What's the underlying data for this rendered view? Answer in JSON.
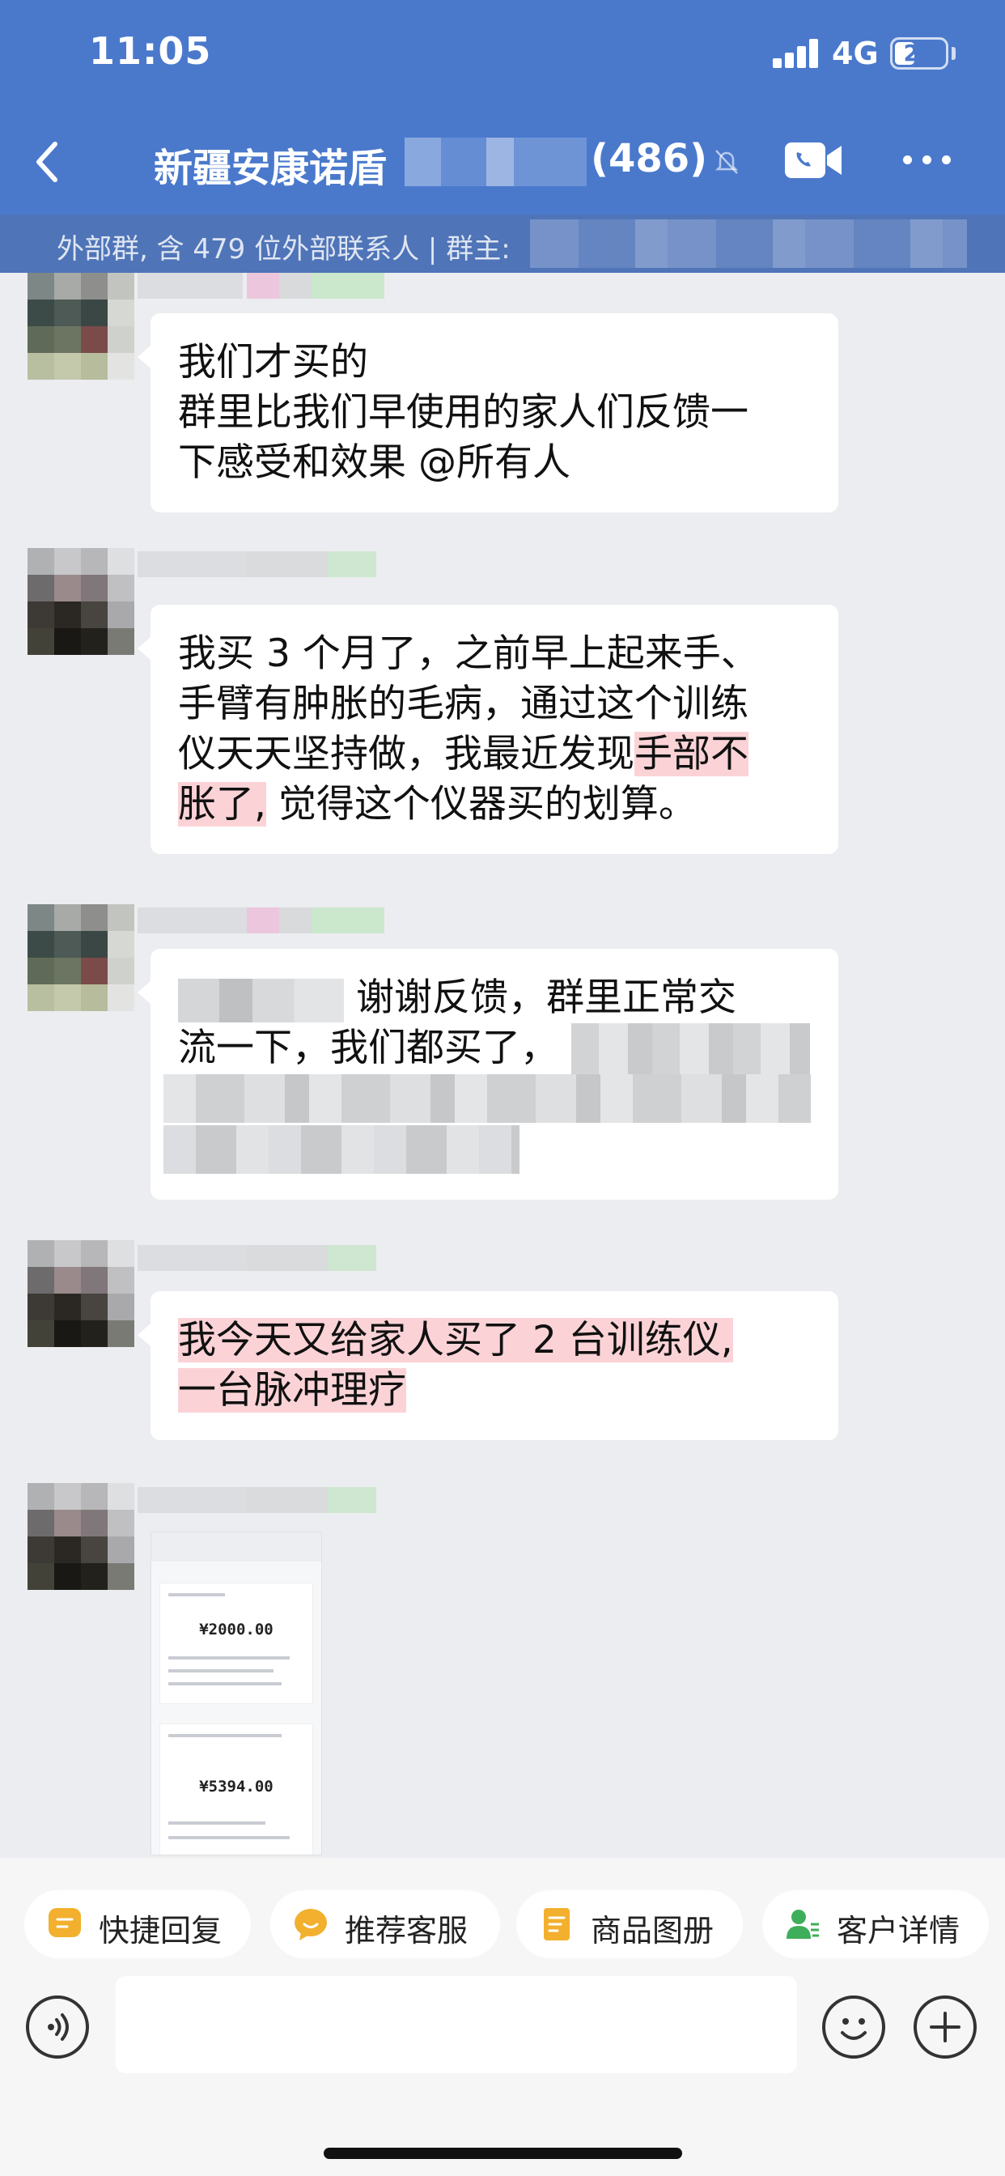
{
  "status_bar": {
    "time": "11:05",
    "network": "4G",
    "battery": "21"
  },
  "nav": {
    "title": "新疆安康诺盾",
    "member_count": "(486)"
  },
  "subheader": {
    "text": "外部群, 含 479 位外部联系人 | 群主:"
  },
  "messages": [
    {
      "lines": [
        "我们才买的",
        "群里比我们早使用的家人们反馈一",
        "下感受和效果 @所有人"
      ]
    },
    {
      "part1": "我买 3 个月了，之前早上起来手、",
      "part2": "手臂有肿胀的毛病，通过这个训练",
      "part3": "仪天天坚持做，我最近发现",
      "highlight1": "手部不",
      "highlight2": "胀了,",
      "part4": " 觉得这个仪器买的划算。"
    },
    {
      "text_a": " 谢谢反馈，群里正常交",
      "text_b": "流一下，我们都买了，"
    },
    {
      "highlight_a": "我今天又给家人买了 2 台训练仪,",
      "highlight_b": "一台脉冲理疗"
    }
  ],
  "image_message": {
    "amount_1": "¥2000.00",
    "amount_2": "¥5394.00"
  },
  "quick_actions": [
    {
      "label": "快捷回复",
      "icon": "quick-reply-icon",
      "color": "#f2b02e"
    },
    {
      "label": "推荐客服",
      "icon": "recommend-service-icon",
      "color": "#f2b02e"
    },
    {
      "label": "商品图册",
      "icon": "product-album-icon",
      "color": "#f2b02e"
    },
    {
      "label": "客户详情",
      "icon": "customer-detail-icon",
      "color": "#3fae5a"
    }
  ],
  "colors": {
    "header": "#4a79cc",
    "highlight": "#fbd3d7"
  }
}
